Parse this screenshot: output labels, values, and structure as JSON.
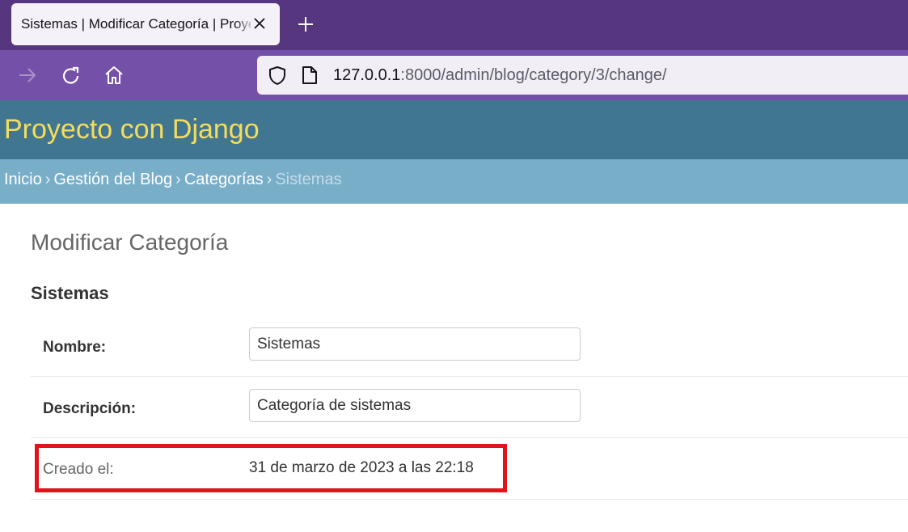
{
  "browser": {
    "tab_title": "Sistemas | Modificar Categoría | Proyecto con Django",
    "url_host": "127.0.0.1",
    "url_rest": ":8000/admin/blog/category/3/change/"
  },
  "admin": {
    "branding": "Proyecto con Django",
    "breadcrumbs": {
      "home": "Inicio",
      "app": "Gestión del Blog",
      "model": "Categorías",
      "current": "Sistemas",
      "separator": "›"
    },
    "page_title": "Modificar Categoría",
    "object_title": "Sistemas",
    "form": {
      "nombre_label": "Nombre:",
      "nombre_value": "Sistemas",
      "descripcion_label": "Descripción:",
      "descripcion_value": "Categoría de sistemas",
      "creado_label": "Creado el:",
      "creado_value": "31 de marzo de 2023 a las 22:18"
    }
  },
  "colors": {
    "tab_strip": "#56377f",
    "nav_bar": "#7550a8",
    "header": "#417690",
    "branding": "#f5dd5d",
    "breadcrumbs": "#79aec8",
    "highlight": "#e3131c"
  },
  "icons": [
    "close-icon",
    "plus-icon",
    "forward-arrow-icon",
    "reload-icon",
    "home-icon",
    "shield-icon",
    "page-icon"
  ]
}
